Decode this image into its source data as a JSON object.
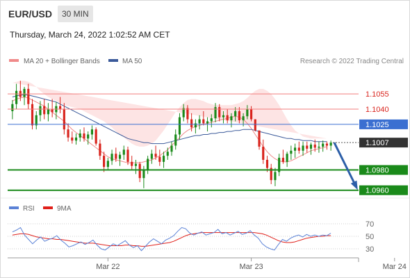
{
  "header": {
    "symbol": "EUR/USD",
    "timeframe": "30 MIN",
    "timestamp": "Thursday, March 24, 2022 1:02:52 AM CET"
  },
  "colors": {
    "ma20": "#f08a8a",
    "ma50": "#3b5a9a",
    "band_fill": "#fde4e4",
    "support": "#1a8a1a",
    "resistance_line": "#f27c7c",
    "pivot_line": "#3b6fd1",
    "arrow": "#2d5fa8",
    "candle_up": "#1a8a1a",
    "candle_down": "#d9241d",
    "rsi": "#5b82d6",
    "rsi_ma": "#e0201a"
  },
  "legend": {
    "ma20_label": "MA 20 + Bollinger Bands",
    "ma50_label": "MA 50",
    "credit": "Research © 2022 Trading Central"
  },
  "rsi_legend": {
    "rsi_label": "RSI",
    "ma_label": "9MA"
  },
  "chart_data": [
    {
      "type": "candlestick",
      "ylim": [
        1.0955,
        1.1075
      ],
      "x_ticks": [
        {
          "label": "Mar 22",
          "index": 24
        },
        {
          "label": "Mar 23",
          "index": 60
        },
        {
          "label": "Mar 24",
          "index": 96
        }
      ],
      "candles": [
        [
          1.1038,
          1.1049,
          1.103,
          1.1045
        ],
        [
          1.1045,
          1.1065,
          1.104,
          1.1058
        ],
        [
          1.1058,
          1.1068,
          1.1048,
          1.1052
        ],
        [
          1.1052,
          1.1062,
          1.1044,
          1.106
        ],
        [
          1.106,
          1.1065,
          1.104,
          1.1045
        ],
        [
          1.1045,
          1.105,
          1.102,
          1.1024
        ],
        [
          1.1024,
          1.1038,
          1.102,
          1.1034
        ],
        [
          1.1034,
          1.1048,
          1.1028,
          1.1043
        ],
        [
          1.1043,
          1.105,
          1.103,
          1.1035
        ],
        [
          1.1035,
          1.1046,
          1.1028,
          1.104
        ],
        [
          1.104,
          1.105,
          1.1032,
          1.1037
        ],
        [
          1.1037,
          1.1047,
          1.103,
          1.1043
        ],
        [
          1.1043,
          1.1052,
          1.1036,
          1.104
        ],
        [
          1.104,
          1.1046,
          1.1015,
          1.102
        ],
        [
          1.102,
          1.1026,
          1.1008,
          1.1012
        ],
        [
          1.1012,
          1.1018,
          1.1006,
          1.1009
        ],
        [
          1.1009,
          1.1016,
          1.1005,
          1.1012
        ],
        [
          1.1012,
          1.102,
          1.1008,
          1.1016
        ],
        [
          1.1016,
          1.1022,
          1.1008,
          1.1011
        ],
        [
          1.1011,
          1.1018,
          1.1005,
          1.1015
        ],
        [
          1.1015,
          1.1024,
          1.101,
          1.102
        ],
        [
          1.102,
          1.1022,
          1.1004,
          1.1006
        ],
        [
          1.1006,
          1.101,
          1.099,
          1.0994
        ],
        [
          1.0994,
          1.0998,
          1.0978,
          1.0983
        ],
        [
          1.0983,
          1.0992,
          1.098,
          1.0989
        ],
        [
          1.0989,
          1.1,
          1.0985,
          1.0996
        ],
        [
          1.0996,
          1.1002,
          1.0988,
          1.0991
        ],
        [
          1.0991,
          1.0998,
          1.0984,
          1.0995
        ],
        [
          1.0995,
          1.1004,
          1.099,
          1.1
        ],
        [
          1.1,
          1.1003,
          1.0985,
          1.0988
        ],
        [
          1.0988,
          1.0994,
          1.098,
          1.0984
        ],
        [
          1.0984,
          1.099,
          1.0976,
          1.0986
        ],
        [
          1.0986,
          1.0988,
          1.0968,
          1.0972
        ],
        [
          1.0972,
          1.0984,
          1.0962,
          1.098
        ],
        [
          1.098,
          1.0994,
          1.0976,
          1.0991
        ],
        [
          1.0991,
          1.1,
          1.0986,
          1.0996
        ],
        [
          1.0996,
          1.1004,
          1.099,
          1.0993
        ],
        [
          1.0993,
          1.1,
          1.0984,
          1.0988
        ],
        [
          1.0988,
          1.0998,
          1.0982,
          1.0994
        ],
        [
          1.0994,
          1.1002,
          1.099,
          1.0998
        ],
        [
          1.0998,
          1.1008,
          1.0994,
          1.1004
        ],
        [
          1.1004,
          1.102,
          1.1,
          1.1015
        ],
        [
          1.1015,
          1.1036,
          1.101,
          1.1032
        ],
        [
          1.1032,
          1.1045,
          1.1028,
          1.1041
        ],
        [
          1.1041,
          1.1044,
          1.1026,
          1.103
        ],
        [
          1.103,
          1.1036,
          1.1018,
          1.1022
        ],
        [
          1.1022,
          1.103,
          1.1016,
          1.1026
        ],
        [
          1.1026,
          1.1034,
          1.102,
          1.103
        ],
        [
          1.103,
          1.1038,
          1.1024,
          1.1026
        ],
        [
          1.1026,
          1.1032,
          1.1018,
          1.1028
        ],
        [
          1.1028,
          1.1035,
          1.1022,
          1.1031
        ],
        [
          1.1031,
          1.1046,
          1.1027,
          1.1042
        ],
        [
          1.1042,
          1.1045,
          1.1028,
          1.1032
        ],
        [
          1.1032,
          1.1038,
          1.1026,
          1.1034
        ],
        [
          1.1034,
          1.104,
          1.1026,
          1.1029
        ],
        [
          1.1029,
          1.1036,
          1.1022,
          1.1033
        ],
        [
          1.1033,
          1.1042,
          1.1028,
          1.1038
        ],
        [
          1.1038,
          1.1042,
          1.1026,
          1.1029
        ],
        [
          1.1029,
          1.1036,
          1.1023,
          1.1033
        ],
        [
          1.1033,
          1.1044,
          1.103,
          1.104
        ],
        [
          1.104,
          1.1043,
          1.1028,
          1.103
        ],
        [
          1.103,
          1.103,
          1.1018,
          1.1019
        ],
        [
          1.1019,
          1.1004,
          1.1,
          1.1003
        ],
        [
          1.1003,
          1.101,
          1.0986,
          1.099
        ],
        [
          1.099,
          1.0994,
          1.0978,
          1.0982
        ],
        [
          1.0982,
          1.0986,
          1.0966,
          1.097
        ],
        [
          1.097,
          1.0982,
          1.0964,
          1.0978
        ],
        [
          1.0978,
          1.0996,
          1.0974,
          1.0992
        ],
        [
          1.0992,
          1.1,
          1.0986,
          1.0988
        ],
        [
          1.0988,
          1.0998,
          1.0983,
          1.0996
        ],
        [
          1.0996,
          1.1004,
          1.099,
          1.0999
        ],
        [
          1.0999,
          1.1006,
          1.0992,
          1.1002
        ],
        [
          1.1002,
          1.1008,
          1.0996,
          1.0999
        ],
        [
          1.0999,
          1.1008,
          1.0994,
          1.1004
        ],
        [
          1.1004,
          1.1008,
          1.0997,
          1.1001
        ],
        [
          1.1001,
          1.1007,
          1.0995,
          1.1005
        ],
        [
          1.1005,
          1.101,
          1.0998,
          1.1002
        ],
        [
          1.1002,
          1.1008,
          1.0997,
          1.1003
        ],
        [
          1.1003,
          1.1009,
          1.0998,
          1.1006
        ],
        [
          1.1006,
          1.1008,
          1.1,
          1.1004
        ],
        [
          1.1004,
          1.1009,
          1.0999,
          1.1007
        ]
      ],
      "ma20": [
        1.1048,
        1.105,
        1.1051,
        1.1052,
        1.1051,
        1.1049,
        1.1047,
        1.1045,
        1.1043,
        1.104,
        1.1037,
        1.1034,
        1.1031,
        1.1028,
        1.1024,
        1.102,
        1.1017,
        1.1014,
        1.1011,
        1.1008,
        1.1005,
        1.1002,
        1.0999,
        1.0996,
        1.0993,
        1.0991,
        1.099,
        1.0989,
        1.0988,
        1.0987,
        1.0987,
        1.0987,
        1.0987,
        1.0988,
        1.0989,
        1.099,
        1.0992,
        1.0994,
        1.0997,
        1.1,
        1.1004,
        1.1008,
        1.1012,
        1.1016,
        1.1019,
        1.1021,
        1.1023,
        1.1024,
        1.1025,
        1.1026,
        1.1027,
        1.1028,
        1.1029,
        1.103,
        1.1031,
        1.1032,
        1.1033,
        1.1032,
        1.103,
        1.1026,
        1.1021,
        1.1015,
        1.1009,
        1.1003,
        1.0998,
        1.0994,
        1.0991,
        1.0989,
        1.0988,
        1.0988,
        1.0989,
        1.0991,
        1.0993,
        1.0995,
        1.0997,
        1.0999,
        1.1,
        1.1001,
        1.1002,
        1.1003
      ],
      "bb_upper": [
        1.1066,
        1.1067,
        1.1068,
        1.1068,
        1.1067,
        1.1065,
        1.1062,
        1.1058,
        1.1055,
        1.1052,
        1.105,
        1.1048,
        1.1046,
        1.1044,
        1.1043,
        1.1042,
        1.1041,
        1.104,
        1.1038,
        1.1036,
        1.1034,
        1.1032,
        1.103,
        1.1028,
        1.1025,
        1.1022,
        1.1018,
        1.1015,
        1.1012,
        1.1009,
        1.1006,
        1.1004,
        1.1003,
        1.1003,
        1.1004,
        1.1006,
        1.1009,
        1.1014,
        1.1019,
        1.1025,
        1.1031,
        1.1037,
        1.1042,
        1.1046,
        1.1049,
        1.105,
        1.105,
        1.1049,
        1.1048,
        1.1046,
        1.1045,
        1.1044,
        1.1044,
        1.1044,
        1.1044,
        1.1044,
        1.1045,
        1.1046,
        1.1048,
        1.1051,
        1.1055,
        1.1058,
        1.106,
        1.106,
        1.1058,
        1.1055,
        1.105,
        1.1044,
        1.1037,
        1.103,
        1.1024,
        1.1019,
        1.1016,
        1.1013,
        1.1012,
        1.1011,
        1.1011,
        1.1011,
        1.1011,
        1.1011
      ],
      "bb_lower": [
        1.103,
        1.1033,
        1.1034,
        1.1036,
        1.1035,
        1.1033,
        1.1032,
        1.1032,
        1.1031,
        1.1028,
        1.1024,
        1.102,
        1.1016,
        1.1012,
        1.1005,
        1.0998,
        1.0993,
        1.0988,
        1.0984,
        1.098,
        1.0976,
        1.0972,
        1.0968,
        1.0964,
        1.0961,
        1.096,
        1.0962,
        1.0963,
        1.0964,
        1.0965,
        1.0968,
        1.097,
        1.0971,
        1.0973,
        1.0974,
        1.0974,
        1.0975,
        1.0974,
        1.0975,
        1.0975,
        1.0977,
        1.0979,
        1.0982,
        1.0986,
        1.0989,
        1.0992,
        1.0996,
        1.0999,
        1.1002,
        1.1006,
        1.1009,
        1.1012,
        1.1014,
        1.1016,
        1.1018,
        1.102,
        1.1021,
        1.1018,
        1.1012,
        1.1001,
        1.0987,
        1.0972,
        1.0958,
        1.0946,
        1.0938,
        1.0933,
        1.0932,
        1.0934,
        1.0939,
        1.0946,
        1.0954,
        1.0963,
        1.097,
        1.0977,
        1.0982,
        1.0987,
        1.0989,
        1.0991,
        1.0993,
        1.0995
      ],
      "ma50": [
        1.1052,
        1.1053,
        1.1054,
        1.1054,
        1.1054,
        1.1053,
        1.1052,
        1.1051,
        1.105,
        1.1049,
        1.1048,
        1.1047,
        1.1045,
        1.1043,
        1.1041,
        1.1039,
        1.1037,
        1.1035,
        1.1033,
        1.1031,
        1.1029,
        1.1027,
        1.1025,
        1.1023,
        1.1021,
        1.1019,
        1.1017,
        1.1015,
        1.1013,
        1.1011,
        1.101,
        1.1009,
        1.1008,
        1.1007,
        1.1007,
        1.1006,
        1.1006,
        1.1006,
        1.1006,
        1.1007,
        1.1008,
        1.1009,
        1.101,
        1.1011,
        1.1012,
        1.1013,
        1.1014,
        1.1014,
        1.1015,
        1.1015,
        1.1016,
        1.1016,
        1.1017,
        1.1017,
        1.1018,
        1.1018,
        1.1019,
        1.1019,
        1.102,
        1.102,
        1.102,
        1.1019,
        1.1018,
        1.1017,
        1.1016,
        1.1015,
        1.1014,
        1.1013,
        1.1012,
        1.1011,
        1.1011,
        1.101,
        1.101,
        1.1009,
        1.1009,
        1.1009,
        1.1008,
        1.1008,
        1.1008,
        1.1008
      ],
      "levels": [
        {
          "price": 1.1055,
          "label": "1.1055",
          "kind": "resistance"
        },
        {
          "price": 1.104,
          "label": "1.1040",
          "kind": "resistance"
        },
        {
          "price": 1.1025,
          "label": "1.1025",
          "kind": "pivot"
        },
        {
          "price": 1.1007,
          "label": "1.1007",
          "kind": "last"
        },
        {
          "price": 1.098,
          "label": "1.0980",
          "kind": "support"
        },
        {
          "price": 1.096,
          "label": "1.0960",
          "kind": "support"
        }
      ],
      "arrow": {
        "from_price": 1.1007,
        "to_price": 1.096,
        "direction": "down"
      }
    },
    {
      "type": "line",
      "name_labels": [
        "RSI",
        "9MA"
      ],
      "ylim": [
        20,
        80
      ],
      "y_ticks": [
        70,
        50,
        30
      ],
      "series": [
        {
          "name": "RSI",
          "values": [
            57,
            60,
            64,
            52,
            45,
            38,
            44,
            49,
            42,
            45,
            47,
            51,
            44,
            39,
            33,
            35,
            38,
            41,
            37,
            40,
            44,
            36,
            30,
            28,
            33,
            38,
            35,
            39,
            43,
            36,
            32,
            35,
            27,
            34,
            41,
            46,
            42,
            38,
            44,
            47,
            51,
            58,
            64,
            62,
            55,
            52,
            55,
            57,
            52,
            54,
            56,
            61,
            54,
            56,
            52,
            55,
            58,
            53,
            55,
            59,
            52,
            47,
            38,
            33,
            30,
            28,
            37,
            45,
            42,
            47,
            50,
            52,
            49,
            53,
            50,
            52,
            50,
            52,
            51,
            55
          ]
        },
        {
          "name": "9MA",
          "values": [
            52,
            53,
            54,
            54,
            53,
            51,
            49,
            48,
            47,
            46,
            46,
            45,
            45,
            44,
            43,
            42,
            41,
            40,
            39,
            39,
            39,
            38,
            37,
            36,
            35,
            35,
            35,
            35,
            36,
            36,
            35,
            35,
            34,
            34,
            35,
            36,
            37,
            38,
            39,
            40,
            42,
            45,
            48,
            51,
            53,
            54,
            55,
            56,
            56,
            56,
            56,
            56,
            56,
            56,
            56,
            56,
            56,
            56,
            56,
            56,
            56,
            55,
            54,
            52,
            49,
            46,
            43,
            41,
            40,
            40,
            41,
            43,
            45,
            47,
            48,
            49,
            50,
            50,
            51,
            51
          ]
        }
      ]
    }
  ]
}
